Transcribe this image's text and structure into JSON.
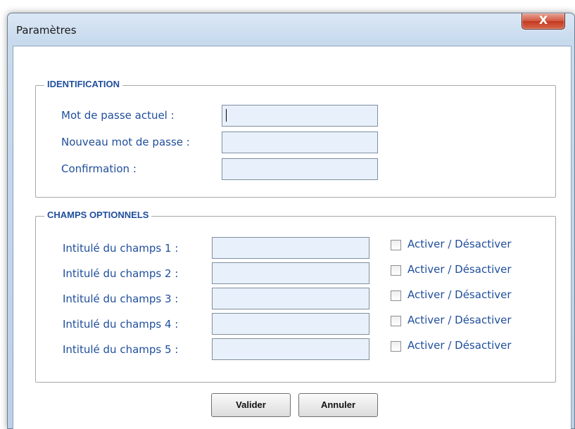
{
  "window": {
    "title": "Paramètres",
    "close_glyph": "X"
  },
  "identification": {
    "title": "IDENTIFICATION",
    "fields": [
      {
        "label": "Mot de passe actuel :",
        "value": ""
      },
      {
        "label": "Nouveau mot de passe :",
        "value": ""
      },
      {
        "label": "Confirmation :",
        "value": ""
      }
    ]
  },
  "optional": {
    "title": "CHAMPS OPTIONNELS",
    "rows": [
      {
        "label": "Intitulé du champs 1 :",
        "value": "",
        "checkbox_label": "Activer / Désactiver",
        "checked": false
      },
      {
        "label": "Intitulé du champs 2 :",
        "value": "",
        "checkbox_label": "Activer / Désactiver",
        "checked": false
      },
      {
        "label": "Intitulé du champs 3 :",
        "value": "",
        "checkbox_label": "Activer / Désactiver",
        "checked": false
      },
      {
        "label": "Intitulé du champs 4 :",
        "value": "",
        "checkbox_label": "Activer / Désactiver",
        "checked": false
      },
      {
        "label": "Intitulé du champs 5 :",
        "value": "",
        "checkbox_label": "Activer / Désactiver",
        "checked": false
      }
    ]
  },
  "buttons": {
    "validate": "Valider",
    "cancel": "Annuler"
  }
}
